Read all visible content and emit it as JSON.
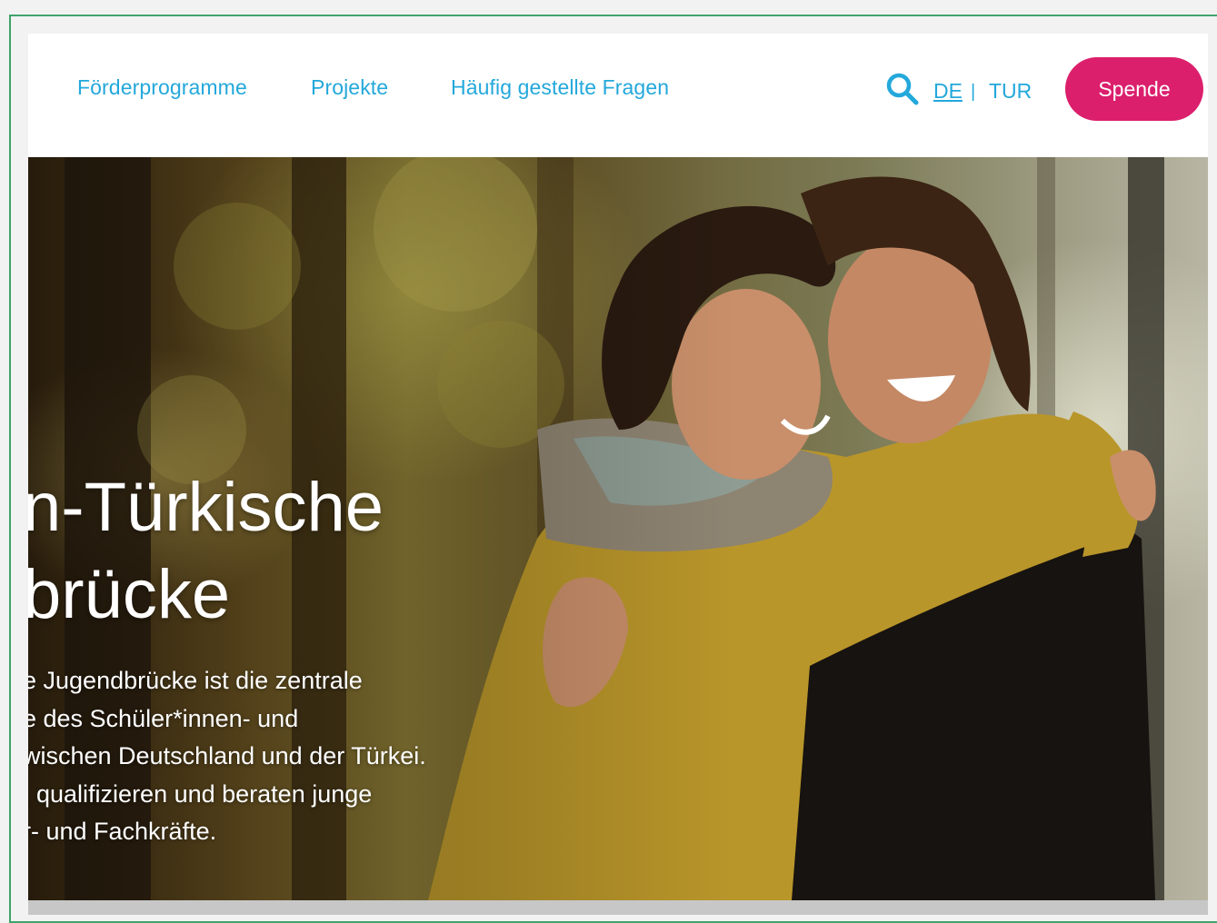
{
  "nav": {
    "links": [
      {
        "label": "Förderprogramme"
      },
      {
        "label": "Projekte"
      },
      {
        "label": "Häufig gestellte Fragen"
      }
    ],
    "lang_de": "DE",
    "lang_separator": "|",
    "lang_tur": "TUR",
    "donate_label": "Spende",
    "search_icon": "search-icon"
  },
  "hero": {
    "title_lines": [
      "n-Türkische",
      "brücke"
    ],
    "text_lines": [
      "e Jugendbrücke ist die zentrale",
      "e des Schüler*innen- und",
      "wischen Deutschland und der Türkei.",
      ", qualifizieren und beraten junge",
      "r- und Fachkräfte."
    ]
  },
  "colors": {
    "link": "#23a8db",
    "donate": "#db1f6c",
    "frame_border": "#3fa36a"
  }
}
